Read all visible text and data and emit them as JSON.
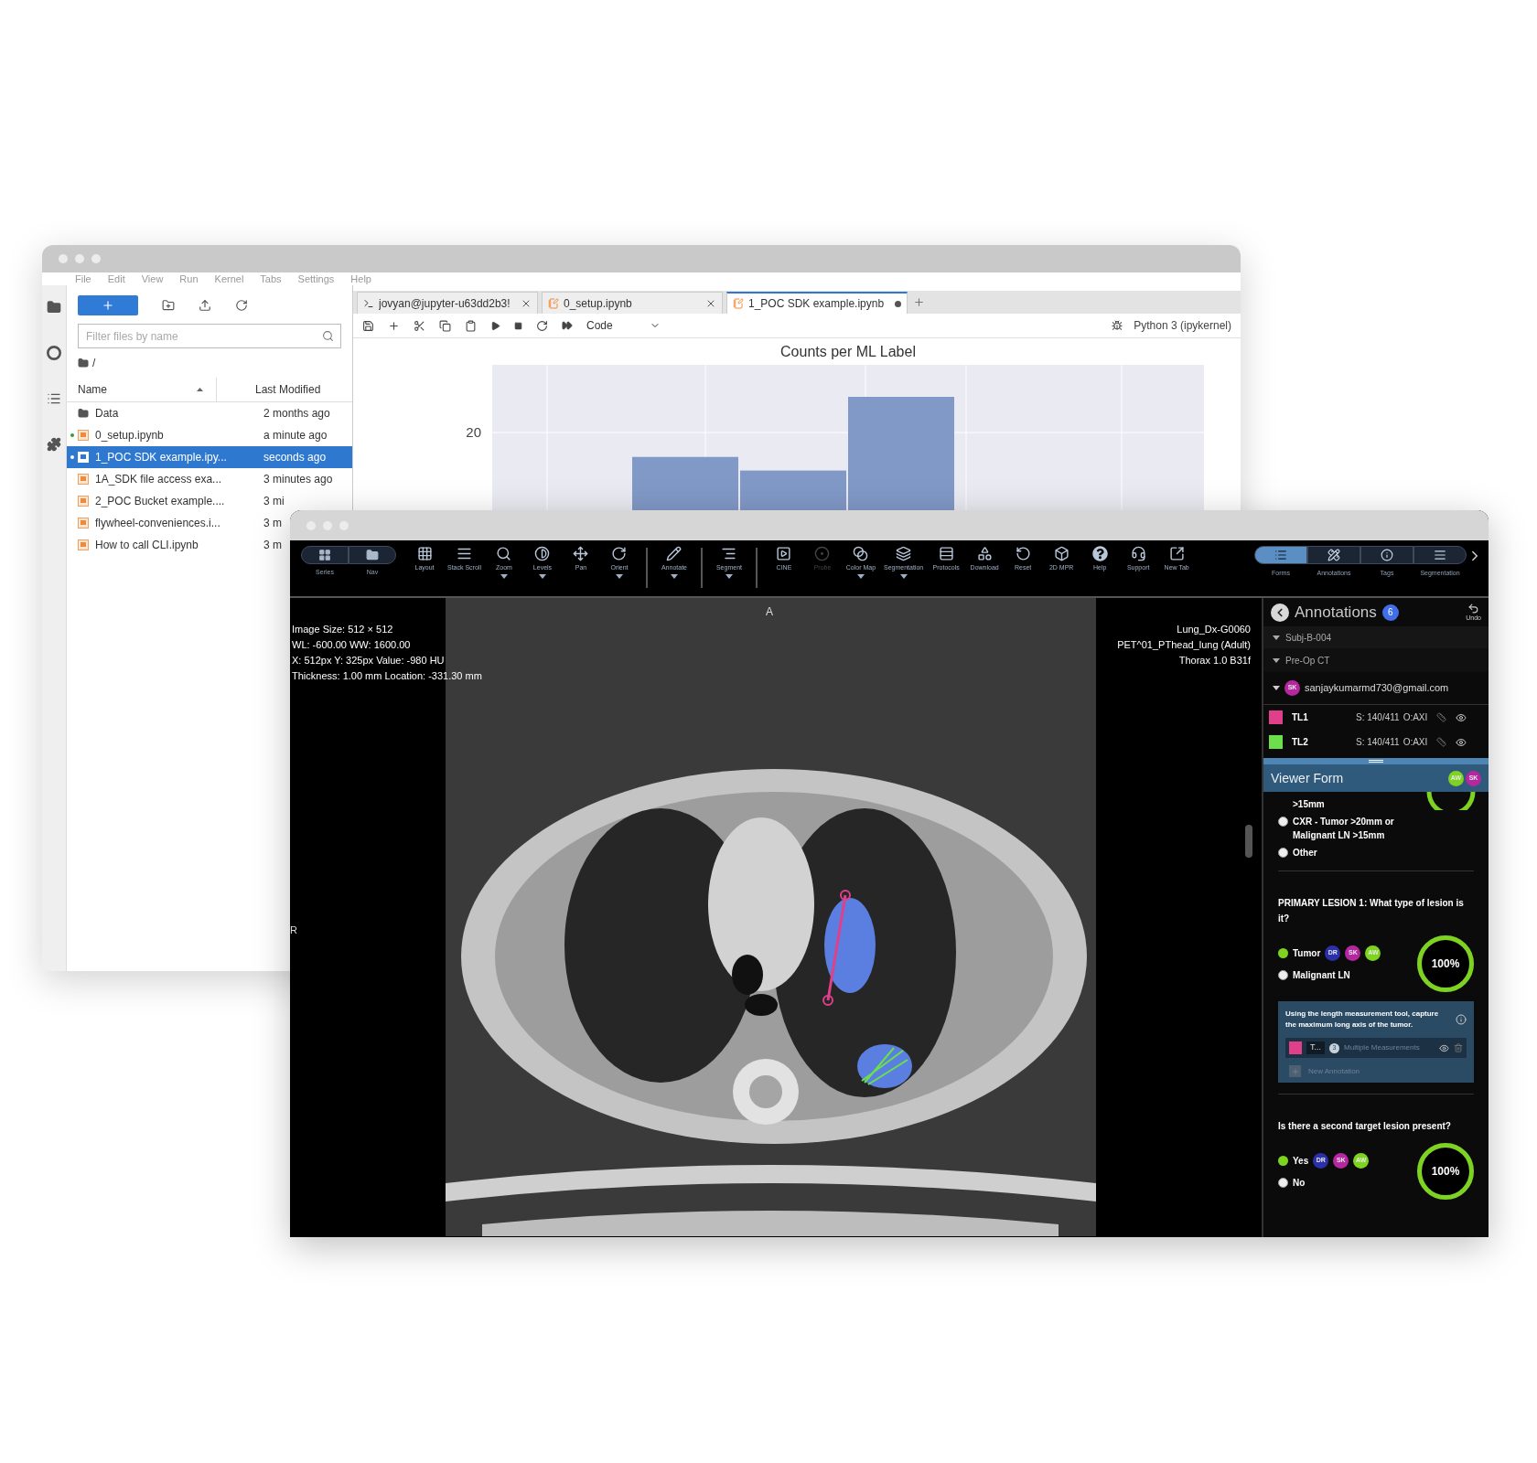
{
  "notebook_window": {
    "menu": [
      "File",
      "Edit",
      "View",
      "Run",
      "Kernel",
      "Tabs",
      "Settings",
      "Help"
    ],
    "file_browser": {
      "filter": {
        "placeholder": "Filter files by name"
      },
      "path": "/",
      "columns": [
        "Name",
        "Last Modified"
      ],
      "files": [
        {
          "name": "Data",
          "modified": "2 months ago",
          "kind": "folder",
          "running": false,
          "selected": false
        },
        {
          "name": "0_setup.ipynb",
          "modified": "a minute ago",
          "kind": "notebook",
          "running": true,
          "selected": false
        },
        {
          "name": "1_POC SDK example.ipy...",
          "modified": "seconds ago",
          "kind": "notebook",
          "running": true,
          "selected": true
        },
        {
          "name": "1A_SDK file access exa...",
          "modified": "3 minutes ago",
          "kind": "notebook",
          "running": false,
          "selected": false
        },
        {
          "name": "2_POC Bucket example....",
          "modified": "3 mi",
          "kind": "notebook",
          "running": false,
          "selected": false
        },
        {
          "name": "flywheel-conveniences.i...",
          "modified": "3 m",
          "kind": "notebook",
          "running": false,
          "selected": false
        },
        {
          "name": "How to call CLI.ipynb",
          "modified": "3 m",
          "kind": "notebook",
          "running": false,
          "selected": false
        }
      ]
    },
    "tabs": [
      {
        "label": "jovyan@jupyter-u63dd2b3!",
        "kind": "terminal",
        "selected": false,
        "unsaved": false
      },
      {
        "label": "0_setup.ipynb",
        "kind": "notebook",
        "selected": false,
        "unsaved": false
      },
      {
        "label": "1_POC SDK example.ipynb",
        "kind": "notebook",
        "selected": true,
        "unsaved": true
      }
    ],
    "cell_type": "Code",
    "kernel": "Python 3 (ipykernel)",
    "chart": {
      "title": "Counts per ML Label",
      "tick_label": "20"
    }
  },
  "viewer_window": {
    "view_switch": [
      "Series",
      "Nav"
    ],
    "toolbar_groups": [
      [
        {
          "label": "Layout",
          "menu": false,
          "disabled": false
        },
        {
          "label": "Stack Scroll",
          "menu": false,
          "disabled": false
        },
        {
          "label": "Zoom",
          "menu": true,
          "disabled": false
        },
        {
          "label": "Levels",
          "menu": true,
          "disabled": false
        },
        {
          "label": "Pan",
          "menu": false,
          "disabled": false
        },
        {
          "label": "Orient",
          "menu": true,
          "disabled": false
        }
      ],
      [
        {
          "label": "Annotate",
          "menu": true,
          "disabled": false
        }
      ],
      [
        {
          "label": "Segment",
          "menu": true,
          "disabled": false
        }
      ],
      [
        {
          "label": "CINE",
          "menu": false,
          "disabled": false
        },
        {
          "label": "Probe",
          "menu": false,
          "disabled": true
        },
        {
          "label": "Color Map",
          "menu": true,
          "disabled": false
        },
        {
          "label": "Segmentation",
          "menu": true,
          "disabled": false
        },
        {
          "label": "Protocols",
          "menu": false,
          "disabled": false
        },
        {
          "label": "Download",
          "menu": false,
          "disabled": false
        },
        {
          "label": "Reset",
          "menu": false,
          "disabled": false
        },
        {
          "label": "2D MPR",
          "menu": false,
          "disabled": false
        },
        {
          "label": "Help",
          "menu": false,
          "disabled": false
        },
        {
          "label": "Support",
          "menu": false,
          "disabled": false
        },
        {
          "label": "New Tab",
          "menu": false,
          "disabled": false
        }
      ]
    ],
    "panel_tabs": [
      {
        "label": "Forms",
        "selected": true
      },
      {
        "label": "Annotations",
        "selected": false
      },
      {
        "label": "Tags",
        "selected": false
      },
      {
        "label": "Segmentation",
        "selected": false
      }
    ],
    "overlay_left": [
      "Image Size: 512 × 512",
      "WL: -600.00 WW: 1600.00",
      "X: 512px Y: 325px Value: -980 HU",
      "Thickness: 1.00 mm Location: -331.30 mm"
    ],
    "overlay_right": [
      "Lung_Dx-G0060",
      "PET^01_PThead_lung (Adult)",
      "Thorax 1.0 B31f"
    ],
    "orientation_top": "A",
    "orientation_left": "R",
    "annotations": {
      "title": "Annotations",
      "count": "6",
      "undo": "Undo",
      "subject": "Subj-B-004",
      "session": "Pre-Op CT",
      "user": {
        "initials": "SK",
        "email": "sanjaykumarmd730@gmail.com",
        "color": "#b5279e"
      },
      "items": [
        {
          "label": "TL1",
          "color": "#e0408a",
          "slice": "S: 140/411",
          "orientation": "O:AXI"
        },
        {
          "label": "TL2",
          "color": "#6be04a",
          "slice": "S: 140/411",
          "orientation": "O:AXI"
        }
      ]
    },
    "form": {
      "title": "Viewer Form",
      "avatars": [
        {
          "initials": "AW",
          "color": "#7ed321"
        },
        {
          "initials": "SK",
          "color": "#b5279e"
        }
      ],
      "top_options": [
        {
          "label": ">15mm",
          "kind": "tail"
        },
        {
          "label": "CXR - Tumor >20mm or Malignant LN >15mm",
          "kind": "radio",
          "selected": false
        },
        {
          "label": "Other",
          "kind": "radio",
          "selected": false
        }
      ],
      "questions": [
        {
          "prompt": "PRIMARY LESION 1: What type of lesion is it?",
          "options": [
            {
              "label": "Tumor",
              "selected": true,
              "voters": [
                {
                  "initials": "DR",
                  "color": "#2b2fa8"
                },
                {
                  "initials": "SK",
                  "color": "#b5279e"
                },
                {
                  "initials": "AW",
                  "color": "#7ed321"
                }
              ]
            },
            {
              "label": "Malignant LN",
              "selected": false
            }
          ],
          "progress": {
            "level": 1,
            "text": "100%"
          },
          "instruction": {
            "text": "Using the length measurement tool, capture the maximum long axis of the tumor.",
            "measurement": {
              "color": "#e0408a",
              "label": "T...",
              "count": "3",
              "description": "Multiple Measurements"
            },
            "add_label": "New Annotation"
          }
        },
        {
          "prompt": "Is there a second target lesion present?",
          "options": [
            {
              "label": "Yes",
              "selected": true,
              "voters": [
                {
                  "initials": "DR",
                  "color": "#2b2fa8"
                },
                {
                  "initials": "SK",
                  "color": "#b5279e"
                },
                {
                  "initials": "AW",
                  "color": "#7ed321"
                }
              ]
            },
            {
              "label": "No",
              "selected": false
            }
          ],
          "progress": {
            "level": 1,
            "text": "100%"
          }
        }
      ]
    }
  }
}
